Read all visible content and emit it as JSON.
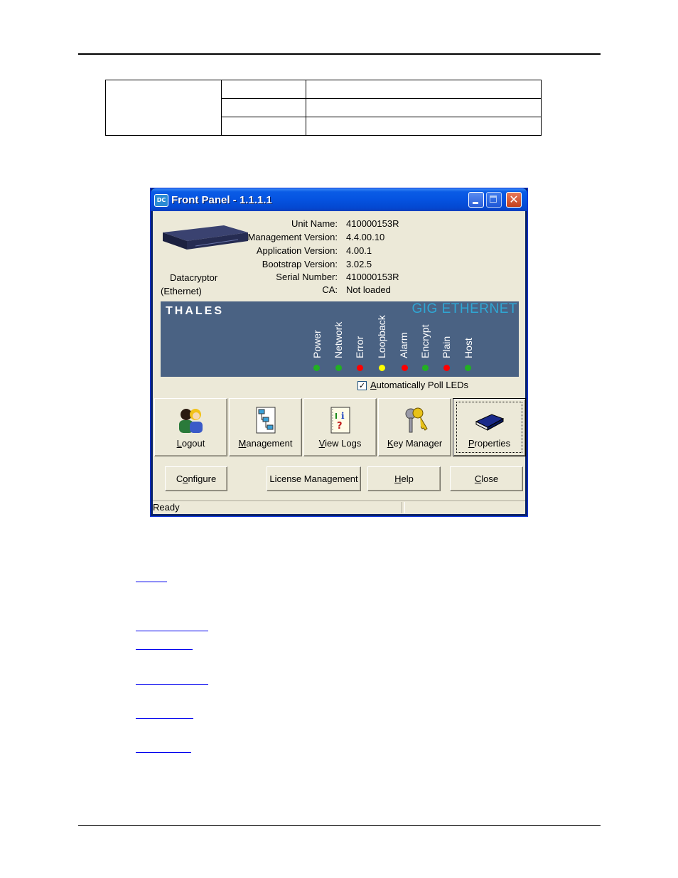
{
  "window": {
    "title": "Front Panel - 1.1.1.1",
    "app_icon": "DC",
    "close_glyph": "✕"
  },
  "device": {
    "name_line1": "Datacryptor",
    "name_line2": "(Ethernet)"
  },
  "info": [
    {
      "label": "Unit Name:",
      "value": "410000153R"
    },
    {
      "label": "Management Version:",
      "value": "4.4.00.10"
    },
    {
      "label": "Application Version:",
      "value": "4.00.1"
    },
    {
      "label": "Bootstrap Version:",
      "value": "3.02.5"
    },
    {
      "label": "Serial Number:",
      "value": "410000153R"
    },
    {
      "label": "CA:",
      "value": "Not loaded"
    }
  ],
  "led_panel": {
    "brand": "THALES",
    "product": "GIG ETHERNET",
    "leds": [
      {
        "label": "Power",
        "color": "#22b022"
      },
      {
        "label": "Network",
        "color": "#22b022"
      },
      {
        "label": "Error",
        "color": "#ff0000"
      },
      {
        "label": "Loopback",
        "color": "#ffff00"
      },
      {
        "label": "Alarm",
        "color": "#ff0000"
      },
      {
        "label": "Encrypt",
        "color": "#22b022"
      },
      {
        "label": "Plain",
        "color": "#ff0000"
      },
      {
        "label": "Host",
        "color": "#22b022"
      }
    ]
  },
  "auto_poll": {
    "checked": true,
    "check_glyph": "✓",
    "label_accel": "A",
    "label_rest": "utomatically Poll LEDs"
  },
  "big_buttons": [
    {
      "accel": "L",
      "rest": "ogout",
      "icon": "users-icon"
    },
    {
      "accel": "M",
      "rest": "anagement",
      "icon": "hierarchy-icon"
    },
    {
      "accel": "V",
      "rest": "iew Logs",
      "icon": "notebook-icon"
    },
    {
      "accel": "K",
      "rest": "ey Manager",
      "icon": "keys-icon"
    },
    {
      "accel": "P",
      "rest": "roperties",
      "icon": "book-icon"
    }
  ],
  "small_buttons": [
    {
      "pre": "C",
      "accel": "o",
      "rest": "nfigure"
    },
    {
      "pre": "",
      "accel": "",
      "rest": "License Management"
    },
    {
      "pre": "",
      "accel": "H",
      "rest": "elp"
    },
    {
      "pre": "",
      "accel": "C",
      "rest": "lose"
    }
  ],
  "status": {
    "text": "Ready"
  }
}
